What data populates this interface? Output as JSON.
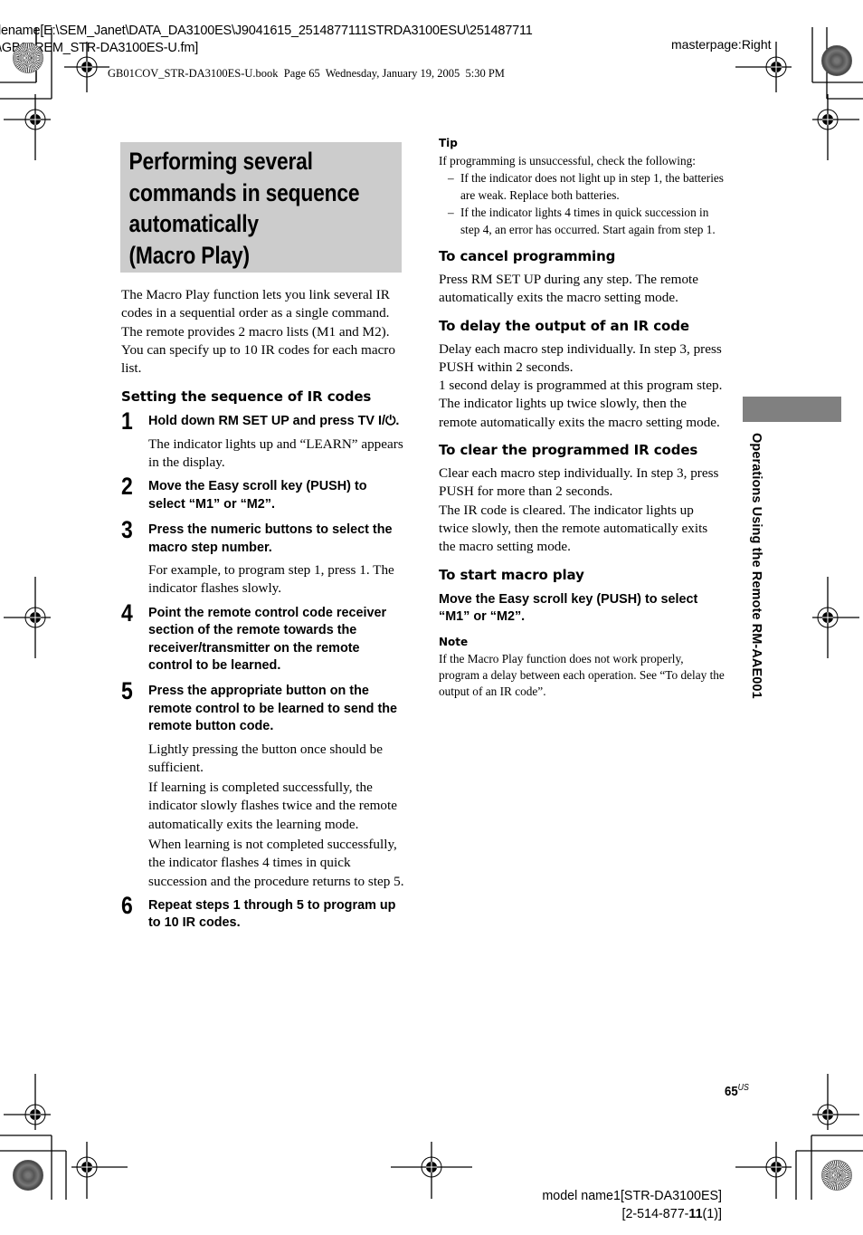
{
  "header": {
    "filename_line1": "lename[E:\\SEM_Janet\\DATA_DA3100ES\\J9041615_2514877111STRDA3100ESU\\251487711",
    "filename_line2": "\\GB08REM_STR-DA3100ES-U.fm]",
    "masterpage": "masterpage:Right",
    "book_info": "GB01COV_STR-DA3100ES-U.book  Page 65  Wednesday, January 19, 2005  5:30 PM"
  },
  "title": {
    "line1": "Performing several",
    "line2": "commands in sequence",
    "line3": "automatically",
    "line4": "(Macro Play)"
  },
  "intro": "The Macro Play function lets you link several IR codes in a sequential order as a single command. The remote provides 2 macro lists (M1 and M2). You can specify up to 10 IR codes for each macro list.",
  "setting_section": {
    "heading": "Setting the sequence of IR codes",
    "steps": [
      {
        "num": "1",
        "title": "Hold down RM SET UP and press TV I/⏻.",
        "body": [
          "The indicator lights up and “LEARN” appears in the display."
        ]
      },
      {
        "num": "2",
        "title": "Move the Easy scroll key (PUSH) to select “M1” or “M2”.",
        "body": []
      },
      {
        "num": "3",
        "title": "Press the numeric buttons to select the macro step number.",
        "body": [
          "For example, to program step 1, press 1. The indicator flashes slowly."
        ]
      },
      {
        "num": "4",
        "title": "Point the remote control code receiver section of the remote towards the receiver/transmitter on the remote control to be learned.",
        "body": []
      },
      {
        "num": "5",
        "title": "Press the appropriate button on the remote control to be learned to send the remote button code.",
        "body": [
          "Lightly pressing the button once should be sufficient.",
          "If learning is completed successfully, the indicator slowly flashes twice and the remote automatically exits the learning mode.",
          "When learning is not completed successfully, the indicator flashes 4 times in quick succession and the procedure returns to step 5."
        ]
      },
      {
        "num": "6",
        "title": "Repeat steps 1 through 5 to program up to 10 IR codes.",
        "body": []
      }
    ]
  },
  "tip": {
    "label": "Tip",
    "intro": "If programming is unsuccessful, check the following:",
    "items": [
      "If the indicator does not light up in step 1, the batteries are weak. Replace both batteries.",
      "If the indicator lights 4 times in quick succession in step 4, an error has occurred. Start again from step 1."
    ],
    "dash": "–"
  },
  "cancel": {
    "heading": "To cancel programming",
    "body": "Press RM SET UP during any step. The remote automatically exits the macro setting mode."
  },
  "delay": {
    "heading": "To delay the output of an IR code",
    "body1": "Delay each macro step individually. In step 3, press PUSH within 2 seconds.",
    "body2": "1 second delay is programmed at this program step. The indicator lights up twice slowly, then the remote automatically exits the macro setting mode."
  },
  "clear": {
    "heading": "To clear the programmed IR codes",
    "body1": "Clear each macro step individually. In step 3, press PUSH for more than 2 seconds.",
    "body2": "The IR code is cleared. The indicator lights up twice slowly, then the remote automatically exits the macro setting mode."
  },
  "start": {
    "heading": "To start macro play",
    "instruction": "Move the Easy scroll key (PUSH) to select “M1” or “M2”."
  },
  "note": {
    "label": "Note",
    "body": "If the Macro Play function does not work properly, program a delay between each operation. See “To delay the output of an IR code”."
  },
  "side_tab": {
    "text": "Operations Using the Remote RM-AAE001",
    "color": "#808080"
  },
  "footer": {
    "page_number": "65",
    "page_suffix": "US",
    "model_line1": "model name1[STR-DA3100ES]",
    "model_line2_prefix": "[2-514-877-",
    "model_line2_bold": "11",
    "model_line2_suffix": "(1)]"
  },
  "colors": {
    "title_bg": "#cccccc",
    "side_tab": "#808080",
    "text": "#000000"
  }
}
